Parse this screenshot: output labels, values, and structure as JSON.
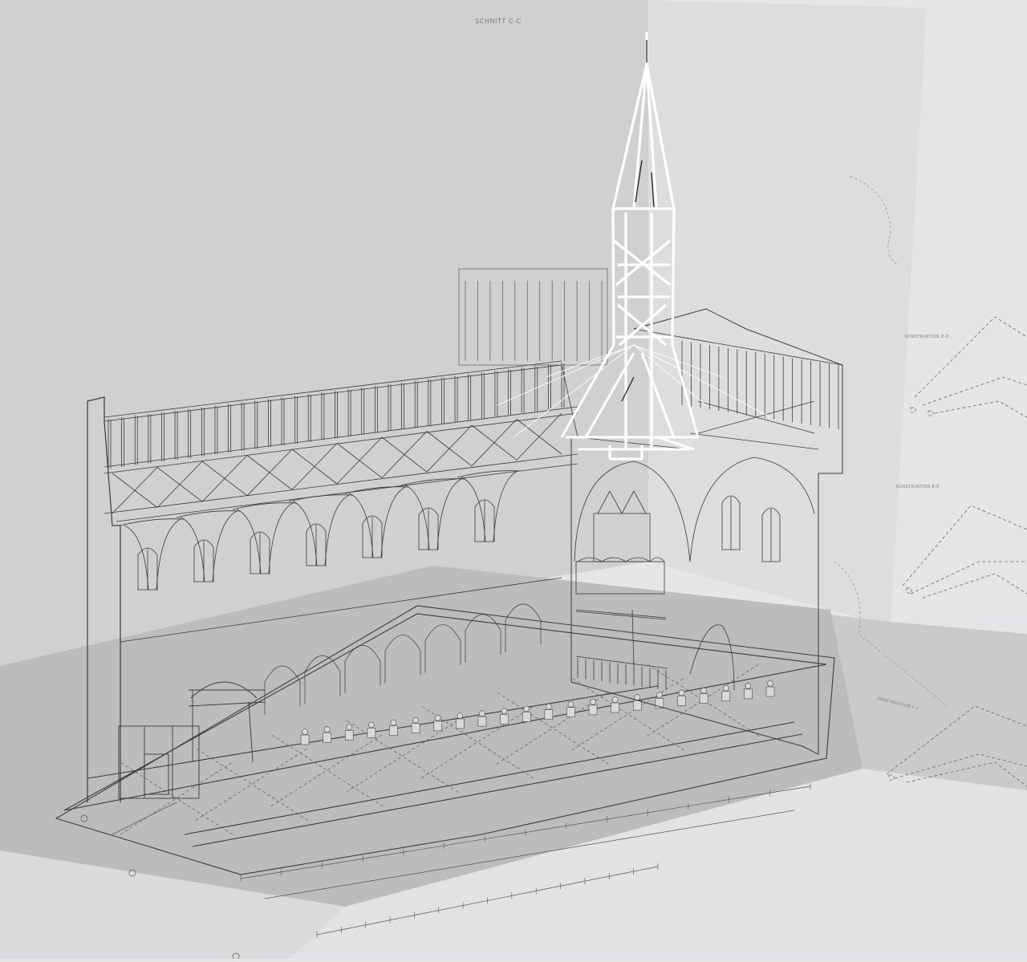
{
  "drawing": {
    "section_title": "SCHNITT C-C",
    "construction_labels": {
      "d": "KONSTRUKTION D-D",
      "e": "KONSTRUKTION E-E",
      "f": "KONSTRUKTION F-F"
    }
  },
  "colors": {
    "background": "#e6e6e7",
    "back_wall_panel": "#cfd0d1",
    "side_wall_panel": "#dadbdc",
    "floor_plane": "#c7c8c9",
    "floor_plane_dark": "#b8b9ba",
    "linework": "#3a3a3a",
    "spire_highlight": "#ffffff"
  },
  "elements": {
    "spire": "white highlighted timber spire frame",
    "longitudinal_section": "church nave longitudinal section with roof truss",
    "cross_section": "church cross section with gallery",
    "floor_plan": "ground floor plan in perspective"
  }
}
